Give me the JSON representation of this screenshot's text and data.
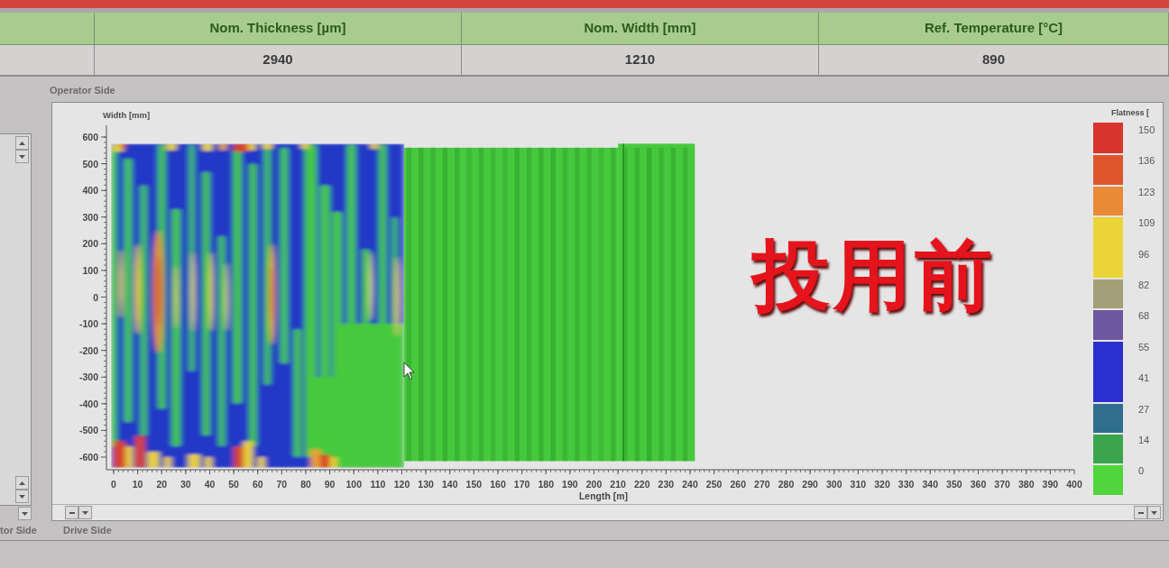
{
  "header_table": {
    "columns": [
      {
        "heading": "Nom. Thickness [µm]",
        "value": "2940"
      },
      {
        "heading": "Nom. Width [mm]",
        "value": "1210"
      },
      {
        "heading": "Ref. Temperature [°C]",
        "value": "890"
      }
    ]
  },
  "plot": {
    "top_label": "Operator Side",
    "y_label": "Width [mm]",
    "y_ticks": [
      "600",
      "500",
      "400",
      "300",
      "200",
      "100",
      "0",
      "-100",
      "-200",
      "-300",
      "-400",
      "-500",
      "-600"
    ],
    "x_ticks": [
      "0",
      "10",
      "20",
      "30",
      "40",
      "50",
      "60",
      "70",
      "80",
      "90",
      "100",
      "110",
      "120",
      "130",
      "140",
      "150",
      "160",
      "170",
      "180",
      "190",
      "200",
      "210",
      "220",
      "230",
      "240",
      "250",
      "260",
      "270",
      "280",
      "290",
      "300",
      "310",
      "320",
      "330",
      "340",
      "350",
      "360",
      "370",
      "380",
      "390",
      "400"
    ],
    "x_label": "Length [m]",
    "annotation": "投用前",
    "bottom_label": "Drive Side"
  },
  "legend": {
    "title": "Flatness [",
    "levels": [
      {
        "label": "150",
        "color": "#d8352e"
      },
      {
        "label": "136",
        "color": "#df552d"
      },
      {
        "label": "123",
        "color": "#e88a37"
      },
      {
        "label": "109",
        "color": "#ebd437"
      },
      {
        "label": "96",
        "color": "#ebd437"
      },
      {
        "label": "82",
        "color": "#a39f79"
      },
      {
        "label": "68",
        "color": "#6e57a0"
      },
      {
        "label": "55",
        "color": "#2b30cf"
      },
      {
        "label": "41",
        "color": "#2b30cf"
      },
      {
        "label": "27",
        "color": "#2f6e8e"
      },
      {
        "label": "14",
        "color": "#3aa54a"
      },
      {
        "label": "0",
        "color": "#50d63b"
      }
    ]
  },
  "side_panel": {
    "footer_label": "tor Side"
  }
}
